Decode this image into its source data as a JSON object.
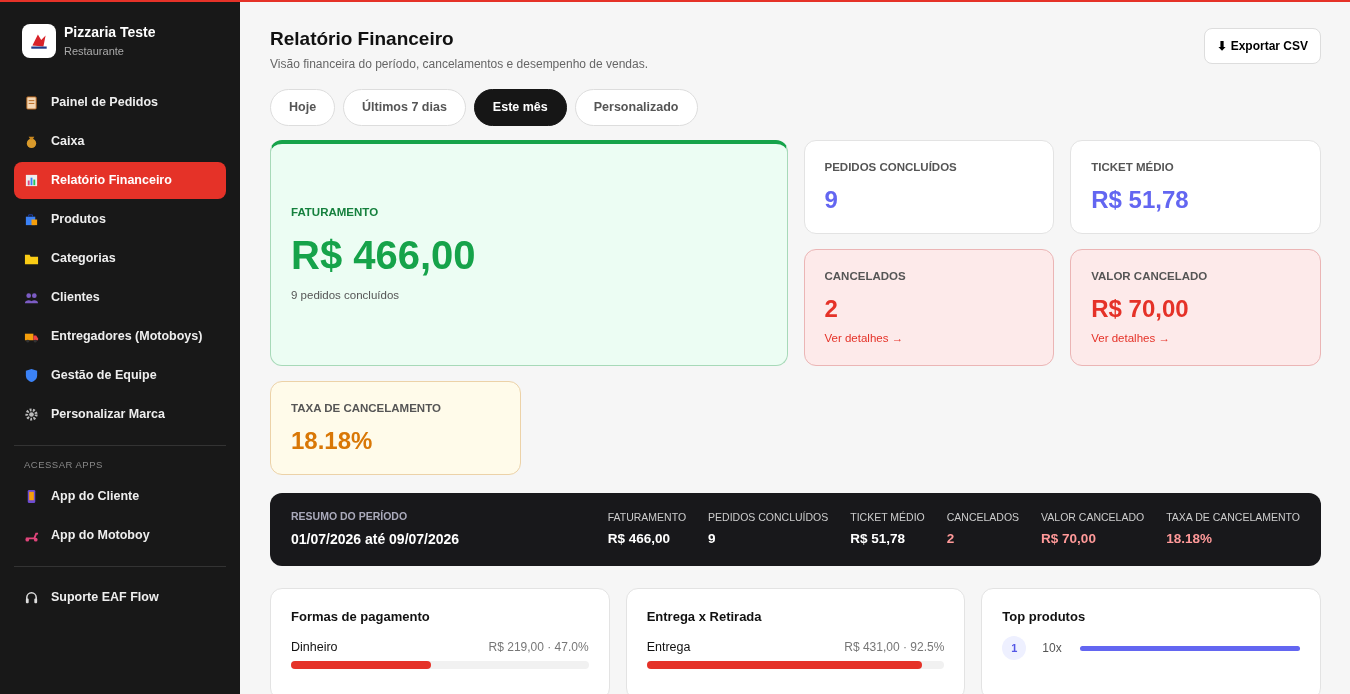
{
  "brand": {
    "name": "Pizzaria Teste",
    "subtitle": "Restaurante"
  },
  "nav": [
    {
      "label": "Painel de Pedidos",
      "selected": false
    },
    {
      "label": "Caixa",
      "selected": false
    },
    {
      "label": "Relatório Financeiro",
      "selected": true
    },
    {
      "label": "Produtos",
      "selected": false
    },
    {
      "label": "Categorias",
      "selected": false
    },
    {
      "label": "Clientes",
      "selected": false
    },
    {
      "label": "Entregadores (Motoboys)",
      "selected": false
    },
    {
      "label": "Gestão de Equipe",
      "selected": false
    },
    {
      "label": "Personalizar Marca",
      "selected": false
    }
  ],
  "apps": {
    "heading": "ACESSAR APPS",
    "items": [
      {
        "label": "App do Cliente",
        "selected": false
      },
      {
        "label": "App do Motoboy",
        "selected": false
      }
    ]
  },
  "support": {
    "label": "Suporte EAF Flow"
  },
  "header": {
    "title": "Relatório Financeiro",
    "subtitle": "Visão financeira do período, cancelamentos e desempenho de vendas.",
    "export_button": "⬇ Exportar CSV"
  },
  "period_tabs": [
    {
      "label": "Hoje",
      "selected": false
    },
    {
      "label": "Últimos 7 dias",
      "selected": false
    },
    {
      "label": "Este mês",
      "selected": true
    },
    {
      "label": "Personalizado",
      "selected": false
    }
  ],
  "metrics": [
    {
      "kind": "hero",
      "label": "FATURAMENTO",
      "value": "R$ 466,00",
      "note": "9 pedidos concluídos"
    },
    {
      "kind": "neutral",
      "label": "PEDIDOS CONCLUÍDOS",
      "value": "9"
    },
    {
      "kind": "neutral",
      "label": "TICKET MÉDIO",
      "value": "R$ 51,78"
    },
    {
      "kind": "danger",
      "label": "CANCELADOS",
      "value": "2",
      "link": "Ver detalhes →"
    },
    {
      "kind": "danger",
      "label": "VALOR CANCELADO",
      "value": "R$ 70,00",
      "link": "Ver detalhes →"
    },
    {
      "kind": "warning",
      "label": "TAXA DE CANCELAMENTO",
      "value": "18.18%"
    }
  ],
  "summary": {
    "label": "RESUMO DO PERÍODO",
    "range": "01/07/2026 até 09/07/2026",
    "items": [
      {
        "label": "FATURAMENTO",
        "value": "R$ 466,00",
        "alert": false
      },
      {
        "label": "PEDIDOS CONCLUÍDOS",
        "value": "9",
        "alert": false
      },
      {
        "label": "TICKET MÉDIO",
        "value": "R$ 51,78",
        "alert": false
      },
      {
        "label": "CANCELADOS",
        "value": "2",
        "alert": true
      },
      {
        "label": "VALOR CANCELADO",
        "value": "R$ 70,00",
        "alert": true
      },
      {
        "label": "TAXA DE CANCELAMENTO",
        "value": "18.18%",
        "alert": true
      }
    ]
  },
  "panels": [
    {
      "kind": "breakdown",
      "title": "Formas de pagamento",
      "rows": [
        {
          "label": "Dinheiro",
          "value": "R$ 219,00 · 47.0%",
          "level": 0.47
        }
      ]
    },
    {
      "kind": "breakdown",
      "title": "Entrega x Retirada",
      "rows": [
        {
          "label": "Entrega",
          "value": "R$ 431,00 · 92.5%",
          "level": 0.925
        }
      ]
    },
    {
      "kind": "ranking",
      "title": "Top produtos",
      "rows": [
        {
          "rank": "1",
          "count": "10x",
          "level": 1.0
        }
      ]
    }
  ]
}
